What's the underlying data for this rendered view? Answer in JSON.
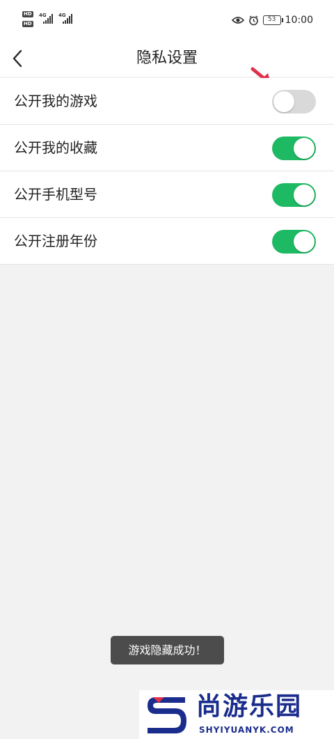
{
  "status_bar": {
    "hd_badge": "HD",
    "network_type": "4G",
    "battery_level": "53",
    "time": "10:00",
    "icons": [
      "eye-icon",
      "alarm-icon",
      "battery-icon"
    ]
  },
  "header": {
    "title": "隐私设置",
    "back_icon": "chevron-left-icon"
  },
  "settings": [
    {
      "label": "公开我的游戏",
      "enabled": false
    },
    {
      "label": "公开我的收藏",
      "enabled": true
    },
    {
      "label": "公开手机型号",
      "enabled": true
    },
    {
      "label": "公开注册年份",
      "enabled": true
    }
  ],
  "toast": {
    "message": "游戏隐藏成功！"
  },
  "watermark": {
    "cn": "尚游乐园",
    "en": "SHYIYUANYK.COM"
  },
  "colors": {
    "toggle_on": "#1dba63",
    "toggle_off": "#d9d9d9",
    "arrow": "#e0304a",
    "watermark": "#1a2c8c"
  }
}
